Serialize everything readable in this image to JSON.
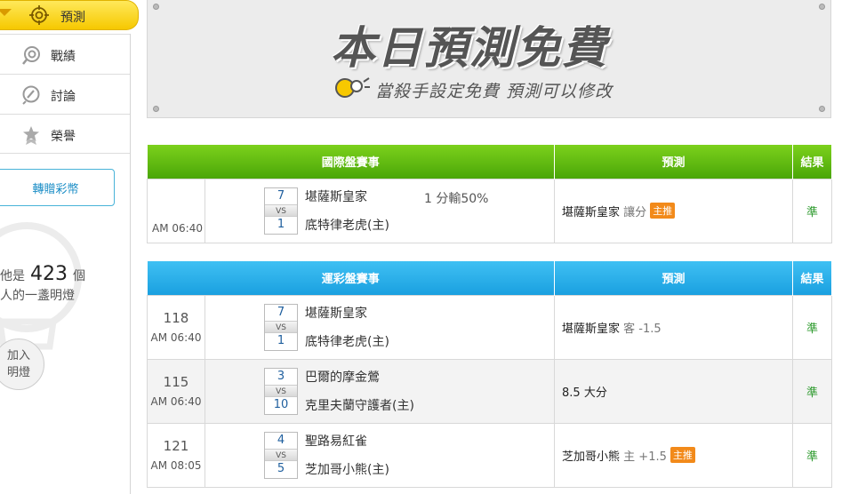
{
  "sidebar": {
    "active": {
      "label": "預測",
      "icon": "target-icon"
    },
    "items": [
      {
        "label": "戰績",
        "icon": "record-icon"
      },
      {
        "label": "討論",
        "icon": "discussion-icon"
      },
      {
        "label": "榮譽",
        "icon": "medal-icon"
      }
    ],
    "gift_button": "轉贈彩幣",
    "lamp": {
      "prefix": "他是",
      "count": "423",
      "suffix": "個",
      "line2": "人的一盞明燈",
      "join_line1": "加入",
      "join_line2": "明燈"
    }
  },
  "banner": {
    "title": "本日預測免費",
    "subtitle": "當殺手設定免費  預測可以修改"
  },
  "intl_table": {
    "headers": [
      "國際盤賽事",
      "預測",
      "結果"
    ],
    "rows": [
      {
        "time": "AM 06:40",
        "away_score": "7",
        "home_score": "1",
        "away": "堪薩斯皇家",
        "home": "底特律老虎(主)",
        "handicap": "1 分輸50%",
        "pred_team": "堪薩斯皇家",
        "pred_extra": "讓分",
        "badge": "主推",
        "result": "準"
      }
    ]
  },
  "lottery_table": {
    "headers": [
      "運彩盤賽事",
      "預測",
      "結果"
    ],
    "rows": [
      {
        "num": "118",
        "time": "AM 06:40",
        "away_score": "7",
        "home_score": "1",
        "away": "堪薩斯皇家",
        "home": "底特律老虎(主)",
        "pred_team": "堪薩斯皇家",
        "pred_extra": "客 -1.5",
        "badge": "",
        "result": "準"
      },
      {
        "num": "115",
        "time": "AM 06:40",
        "away_score": "3",
        "home_score": "10",
        "away": "巴爾的摩金鶯",
        "home": "克里夫蘭守護者(主)",
        "pred_team": "8.5 大分",
        "pred_extra": "",
        "badge": "",
        "result": "準"
      },
      {
        "num": "121",
        "time": "AM 08:05",
        "away_score": "4",
        "home_score": "5",
        "away": "聖路易紅雀",
        "home": "芝加哥小熊(主)",
        "pred_team": "芝加哥小熊",
        "pred_extra": "主 +1.5",
        "badge": "主推",
        "result": "準"
      }
    ]
  },
  "vs_label": "VS",
  "colors": {
    "green_header": "#5cb811",
    "blue_header": "#22a9e8",
    "result": "#2c9a2c",
    "badge": "#f28a1a",
    "active_nav": "#fcd620"
  }
}
